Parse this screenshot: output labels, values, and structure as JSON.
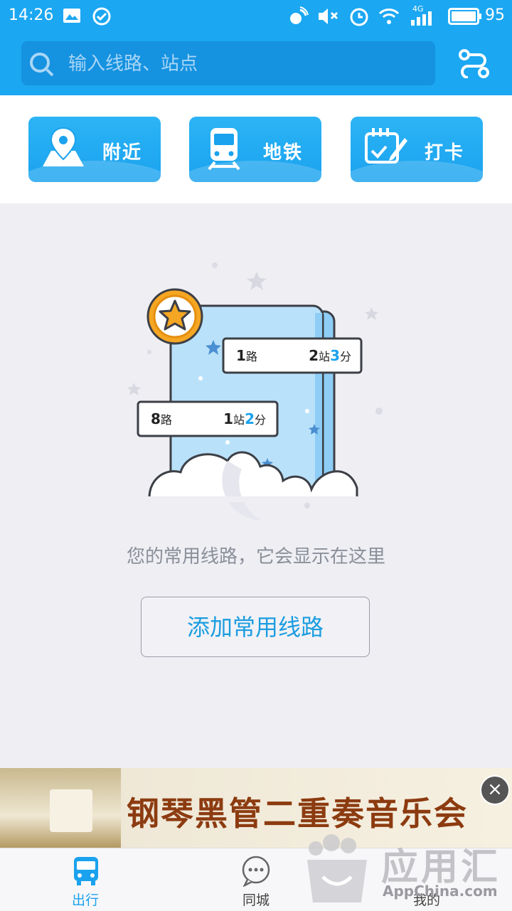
{
  "status_bar": {
    "time": "14:26",
    "battery": "95",
    "network": "4G"
  },
  "search": {
    "placeholder": "输入线路、站点"
  },
  "quick_actions": [
    {
      "label": "附近",
      "icon": "map-pin-icon"
    },
    {
      "label": "地铁",
      "icon": "subway-train-icon"
    },
    {
      "label": "打卡",
      "icon": "checkin-calendar-icon"
    }
  ],
  "illustration": {
    "card1": {
      "route": "1",
      "route_suffix": "路",
      "stops": "2",
      "stops_suffix": "站",
      "mins": "3",
      "mins_suffix": "分"
    },
    "card2": {
      "route": "8",
      "route_suffix": "路",
      "stops": "1",
      "stops_suffix": "站",
      "mins": "2",
      "mins_suffix": "分"
    }
  },
  "empty_state": {
    "message": "您的常用线路，它会显示在这里",
    "add_button": "添加常用线路"
  },
  "ad_banner": {
    "text": "钢琴黑管二重奏音乐会",
    "close": "×"
  },
  "tabs": [
    {
      "label": "出行",
      "active": true
    },
    {
      "label": "同城",
      "active": false
    },
    {
      "label": "我的",
      "active": false
    }
  ],
  "watermark": {
    "title": "应用汇",
    "site": "AppChina.com"
  },
  "colors": {
    "primary": "#1ba7f2",
    "accent_text": "#1c9de0",
    "star": "#f5a623"
  }
}
